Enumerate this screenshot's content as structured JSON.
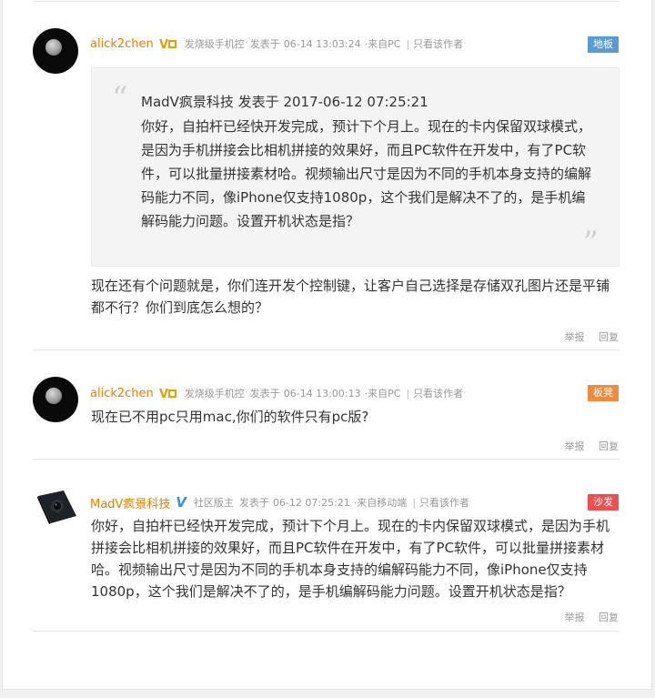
{
  "posts": [
    {
      "username": "alick2chen",
      "level": "发烧级手机控",
      "posted_prefix": "发表于",
      "datetime": "06-14 13:03:24",
      "source": "·来自PC",
      "only_author": "只看该作者",
      "floor": "地板",
      "floor_color": "#5b9bd5",
      "quote": {
        "header": "MadV疯景科技 发表于 2017-06-12 07:25:21",
        "body": "你好，自拍杆已经快开发完成，预计下个月上。现在的卡内保留双球模式，是因为手机拼接会比相机拼接的效果好，而且PC软件在开发中，有了PC软件，可以批量拼接素材哈。视频输出尺寸是因为不同的手机本身支持的编解码能力不同，像iPhone仅支持1080p，这个我们是解决不了的，是手机编解码能力问题。设置开机状态是指？"
      },
      "content": "现在还有个问题就是，你们连开发个控制键，让客户自己选择是存储双孔图片还是平铺都不行？你们到底怎么想的？",
      "report": "举报",
      "reply": "回复"
    },
    {
      "username": "alick2chen",
      "level": "发烧级手机控",
      "posted_prefix": "发表于",
      "datetime": "06-14 13:00:13",
      "source": "·来自PC",
      "only_author": "只看该作者",
      "floor": "板凳",
      "floor_color": "#f08a3c",
      "content": "现在已不用pc只用mac,你们的软件只有pc版?",
      "report": "举报",
      "reply": "回复"
    },
    {
      "username": "MadV疯景科技",
      "level": "社区版主",
      "posted_prefix": "发表于",
      "datetime": "06-12 07:25:21",
      "source": "·来自移动端",
      "only_author": "只看该作者",
      "floor": "沙发",
      "floor_color": "#ef4f4f",
      "content": "你好，自拍杆已经快开发完成，预计下个月上。现在的卡内保留双球模式，是因为手机拼接会比相机拼接的效果好，而且PC软件在开发中，有了PC软件，可以批量拼接素材哈。视频输出尺寸是因为不同的手机本身支持的编解码能力不同，像iPhone仅支持1080p，这个我们是解决不了的，是手机编解码能力问题。设置开机状态是指？",
      "report": "举报",
      "reply": "回复"
    }
  ],
  "quote_marks": {
    "open": "“",
    "close": "”"
  },
  "separator": "|",
  "icons": [
    "vip-level-icon",
    "verified-v-icon",
    "moon-avatar",
    "madv-camera-avatar"
  ]
}
